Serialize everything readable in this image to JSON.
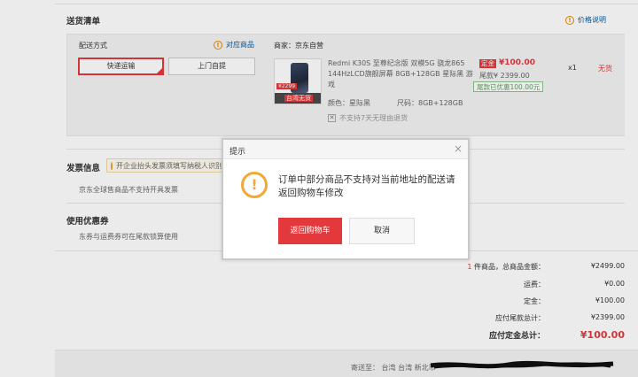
{
  "shipping_list": {
    "title": "送货清单",
    "price_note": "价格说明",
    "delivery_method_label": "配送方式",
    "matching_goods": "对应商品",
    "options": [
      "快递运输",
      "上门自提"
    ],
    "selected_option": "快递运输"
  },
  "product": {
    "seller_label": "商家：",
    "seller_name": "京东自营",
    "name": "Redmi K30S 至尊纪念版 双模5G 骁龙865 144HzLCD旗舰屏幕 8GB+128GB 星际黑 游戏",
    "thumb_price": "¥2299",
    "thumb_banner": "台湾无货",
    "deposit_tag": "定金",
    "deposit_price": "¥100.00",
    "tail_label": "尾款¥",
    "tail_value": "2399.00",
    "tail_discount": "尾款已优惠100.00元",
    "quantity": "x1",
    "stock_status": "无货",
    "color_label": "颜色：",
    "color_value": "星际黑",
    "size_label": "尺码：",
    "size_value": "8GB+128GB",
    "no_return_text": "不支持7天无理由退货"
  },
  "invoice": {
    "title": "发票信息",
    "tip": "开企业抬头发票须填写纳税人识别号",
    "note": "京东全球售商品不支持开具发票"
  },
  "coupon": {
    "title": "使用优惠券",
    "note": "东券与运费券可在尾款锁算使用"
  },
  "summary": {
    "count": "1",
    "count_text": "件商品，总商品金额：",
    "total_goods": "¥2499.00",
    "shipping_label": "运费：",
    "shipping": "¥0.00",
    "deposit_label": "定金：",
    "deposit": "¥100.00",
    "tail_label": "应付尾款总计：",
    "tail": "¥2399.00",
    "pay_label": "应付定金总计：",
    "pay": "¥100.00"
  },
  "footer": {
    "address_label": "寄送至：",
    "address": "台湾 台湾 新北市"
  },
  "dialog": {
    "title": "提示",
    "close": "×",
    "message": "订单中部分商品不支持对当前地址的配送请返回购物车修改",
    "primary_button": "返回购物车",
    "secondary_button": "取消"
  },
  "colors": {
    "accent": "#e4393c",
    "warning": "#f1a836",
    "link": "#005ea7"
  },
  "icons": [
    "info-icon",
    "warning-icon",
    "bulb-icon",
    "close-icon",
    "checkbox-icon"
  ]
}
